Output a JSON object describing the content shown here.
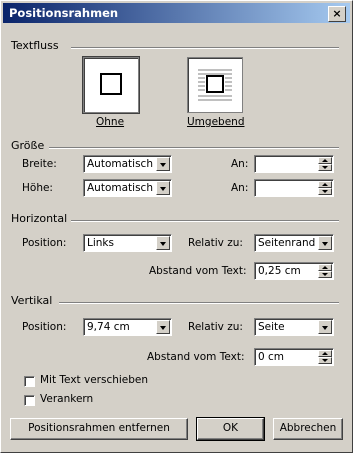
{
  "window": {
    "title": "Positionsrahmen",
    "close_glyph": "×"
  },
  "textfluss": {
    "label": "Textfluss",
    "options": [
      {
        "label": "Ohne",
        "selected": true
      },
      {
        "label": "Umgebend",
        "selected": false
      }
    ]
  },
  "groesse": {
    "label": "Größe",
    "breite_label": "Breite:",
    "breite_value": "Automatisch",
    "hoehe_label": "Höhe:",
    "hoehe_value": "Automatisch",
    "an1_label": "An:",
    "an1_value": "",
    "an2_label": "An:",
    "an2_value": ""
  },
  "horizontal": {
    "label": "Horizontal",
    "position_label": "Position:",
    "position_value": "Links",
    "relativ_label": "Relativ zu:",
    "relativ_value": "Seitenrand",
    "abstand_label": "Abstand vom Text:",
    "abstand_value": "0,25 cm"
  },
  "vertikal": {
    "label": "Vertikal",
    "position_label": "Position:",
    "position_value": "9,74 cm",
    "relativ_label": "Relativ zu:",
    "relativ_value": "Seite",
    "abstand_label": "Abstand vom Text:",
    "abstand_value": "0 cm",
    "mit_text_label": "Mit Text verschieben",
    "mit_text_checked": false,
    "verankern_label": "Verankern",
    "verankern_checked": false
  },
  "buttons": {
    "remove": "Positionsrahmen entfernen",
    "ok": "OK",
    "cancel": "Abbrechen"
  }
}
